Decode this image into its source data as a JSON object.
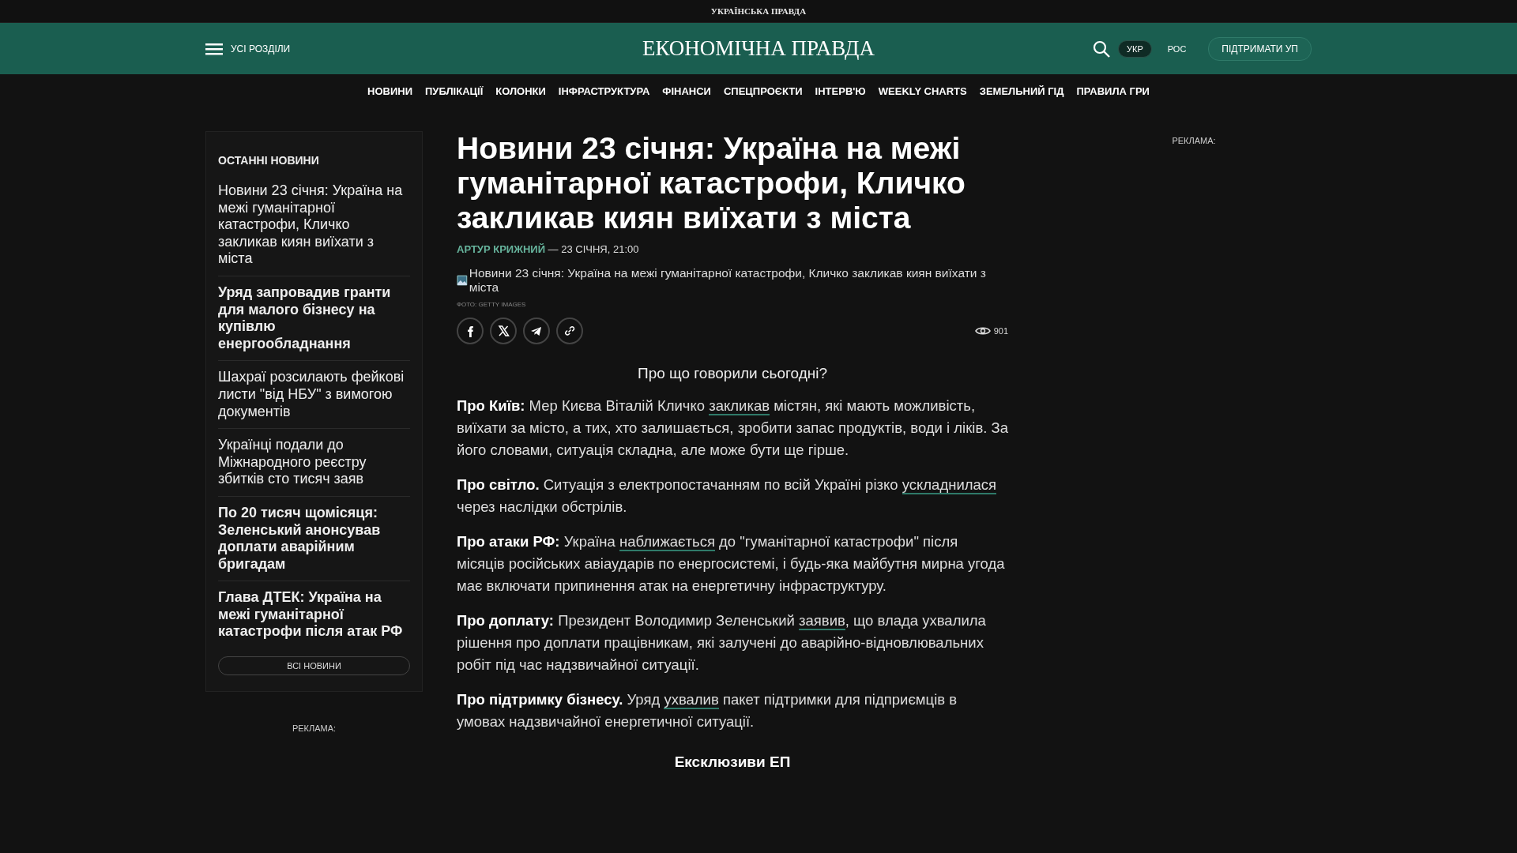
{
  "top_bar": {
    "site": "УКРАЇНСЬКА ПРАВДА"
  },
  "header": {
    "menu_label": "УСІ РОЗДІЛИ",
    "logo": "ЕКОНОМІЧНА ПРАВДА",
    "languages": [
      {
        "label": "УКР",
        "selected": true
      },
      {
        "label": "РОС",
        "selected": false
      }
    ],
    "support_button": "ПІДТРИМАТИ УП"
  },
  "nav": [
    "НОВИНИ",
    "ПУБЛІКАЦІЇ",
    "КОЛОНКИ",
    "ІНФРАСТРУКТУРА",
    "ФІНАНСИ",
    "СПЕЦПРОЄКТИ",
    "ІНТЕРВ'Ю",
    "WEEKLY CHARTS",
    "ЗЕМЕЛЬНИЙ ГІД",
    "ПРАВИЛА ГРИ"
  ],
  "sidebar": {
    "title": "ОСТАННІ НОВИНИ",
    "items": [
      {
        "text": "Новини 23 січня: Україна на межі гуманітарної катастрофи, Кличко закликав киян виїхати з міста",
        "important": false
      },
      {
        "text": "Уряд запровадив гранти для малого бізнесу на купівлю енергообладнання",
        "important": true
      },
      {
        "text": "Шахраї розсилають фейкові листи \"від НБУ\" з вимогою документів",
        "important": false
      },
      {
        "text": "Українці подали до Міжнародного реєстру збитків сто тисяч заяв",
        "important": false
      },
      {
        "text": "По 20 тисяч щомісяця: Зеленський анонсував доплати аварійним бригадам",
        "important": true
      },
      {
        "text": "Глава ДТЕК: Україна на межі гуманітарної катастрофи після атак РФ",
        "important": true
      }
    ],
    "all_button": "ВСІ НОВИНИ",
    "ad_label": "РЕКЛАМА:"
  },
  "article": {
    "title": "Новини 23 січня: Україна на межі гуманітарної катастрофи, Кличко закликав киян виїхати з міста",
    "author": "АРТУР КРИЖНИЙ",
    "date": "— 23 СІЧНЯ, 21:00",
    "image_alt": "Новини 23 січня: Україна на межі гуманітарної катастрофи, Кличко закликав киян виїхати з міста",
    "photo_credit": "ФОТО: GETTY IMAGES",
    "views": "901",
    "intro": "Про що говорили сьогодні?",
    "paragraphs": [
      [
        {
          "kind": "bold",
          "text": "Про Київ:"
        },
        {
          "kind": "text",
          "text": " Мер Києва Віталій Кличко "
        },
        {
          "kind": "link",
          "text": "закликав"
        },
        {
          "kind": "text",
          "text": " містян, які мають можливість, виїхати за місто, а тих, хто залишається, зробити запас продуктів, води і ліків. За його словами, ситуація складна, але може бути ще гірше."
        }
      ],
      [
        {
          "kind": "bold",
          "text": "Про світло."
        },
        {
          "kind": "text",
          "text": " Ситуація з електропостачанням по всій Україні різко "
        },
        {
          "kind": "link",
          "text": "ускладнилася"
        },
        {
          "kind": "text",
          "text": " через наслідки обстрілів."
        }
      ],
      [
        {
          "kind": "bold",
          "text": "Про атаки РФ:"
        },
        {
          "kind": "text",
          "text": " Україна "
        },
        {
          "kind": "link",
          "text": "наближається"
        },
        {
          "kind": "text",
          "text": " до \"гуманітарної катастрофи\" після місяців російських авіаударів по енергосистемі, і будь-яка майбутня мирна угода має включати припинення атак на енергетичну інфраструктуру."
        }
      ],
      [
        {
          "kind": "bold",
          "text": "Про доплату:"
        },
        {
          "kind": "text",
          "text": " Президент Володимир Зеленський "
        },
        {
          "kind": "link",
          "text": "заявив"
        },
        {
          "kind": "text",
          "text": ", що влада ухвалила рішення про доплати працівникам, які залучені до аварійно-відновлювальних робіт під час надзвичайної ситуації."
        }
      ],
      [
        {
          "kind": "bold",
          "text": "Про підтримку бізнесу."
        },
        {
          "kind": "text",
          "text": " Уряд "
        },
        {
          "kind": "link",
          "text": "ухвалив"
        },
        {
          "kind": "text",
          "text": " пакет підтримки для підприємців в умовах надзвичайної енергетичної ситуації."
        }
      ]
    ],
    "section_heading": "Ексклюзиви ЕП"
  },
  "right_ad_label": "РЕКЛАМА:"
}
